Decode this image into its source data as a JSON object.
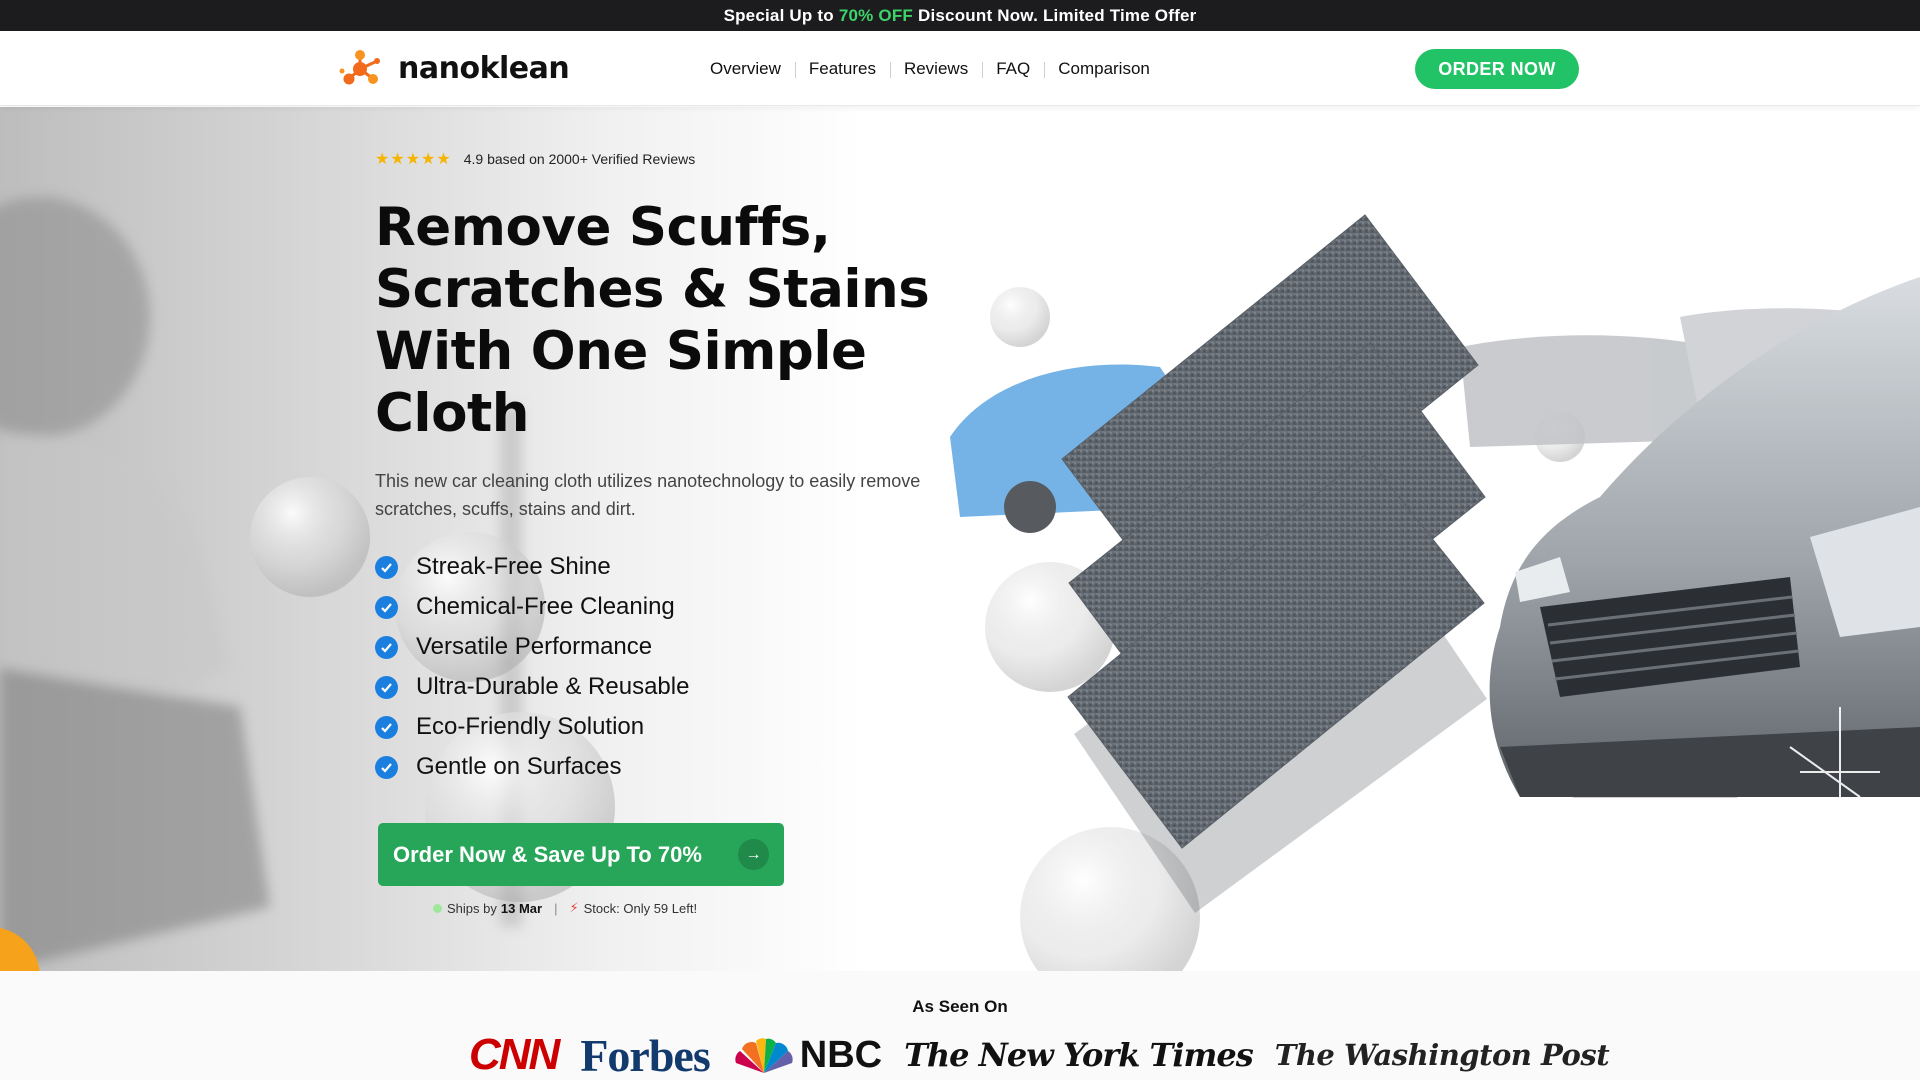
{
  "promo": {
    "prefix": "Special Up to",
    "highlight": "70% OFF",
    "suffix": "Discount Now. Limited Time Offer"
  },
  "header": {
    "logo_text": "nanoklean",
    "nav": [
      "Overview",
      "Features",
      "Reviews",
      "FAQ",
      "Comparison"
    ],
    "order_button": "ORDER NOW"
  },
  "hero": {
    "stars": "★★★★★",
    "rating_text": "4.9 based on 2000+ Verified Reviews",
    "headline": "Remove Scuffs, Scratches & Stains With One Simple Cloth",
    "subtext": "This new car cleaning cloth utilizes nanotechnology to easily remove scratches, scuffs, stains and dirt.",
    "features": [
      "Streak-Free Shine",
      "Chemical-Free Cleaning",
      "Versatile Performance",
      "Ultra-Durable & Reusable",
      "Eco-Friendly Solution",
      "Gentle on Surfaces"
    ],
    "cta_label": "Order Now & Save Up To 70%",
    "ships_label": "Ships by",
    "ships_date": "13 Mar",
    "stock_text": "Stock: Only 59 Left!"
  },
  "seen_on": {
    "title": "As Seen On",
    "logos": [
      "CNN",
      "Forbes",
      "NBC",
      "The New York Times",
      "The Washington Post"
    ]
  },
  "colors": {
    "accent_green": "#3dd46a",
    "button_green": "#22c266",
    "cta_green": "#27a65a",
    "check_blue": "#1b7fe0",
    "star_gold": "#f5b400"
  }
}
